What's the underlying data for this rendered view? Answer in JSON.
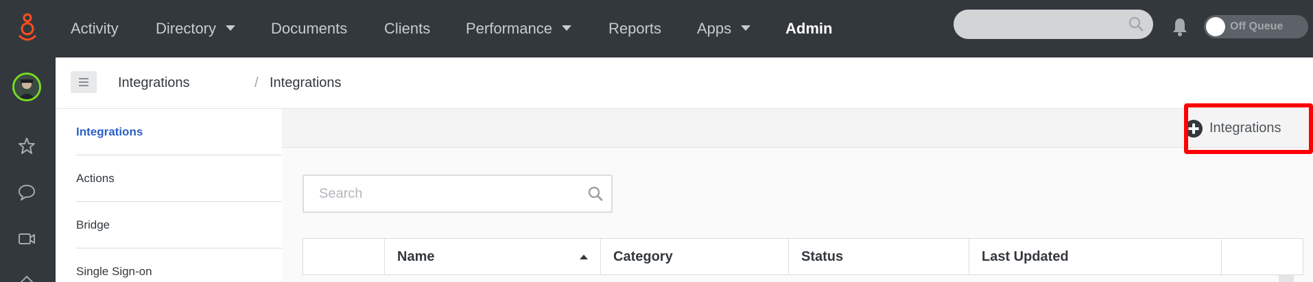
{
  "topnav": {
    "items": [
      {
        "label": "Activity"
      },
      {
        "label": "Directory"
      },
      {
        "label": "Documents"
      },
      {
        "label": "Clients"
      },
      {
        "label": "Performance"
      },
      {
        "label": "Reports"
      },
      {
        "label": "Apps"
      },
      {
        "label": "Admin"
      }
    ],
    "search_placeholder": "",
    "queue_label": "Off Queue",
    "accent_color": "#ff4f1f"
  },
  "rail": {
    "icons": [
      "star-icon",
      "chat-bubble-icon",
      "video-camera-icon"
    ]
  },
  "breadcrumb": {
    "items": [
      "Integrations",
      "Integrations"
    ],
    "separator": "/"
  },
  "subnav": {
    "items": [
      {
        "label": "Integrations"
      },
      {
        "label": "Actions"
      },
      {
        "label": "Bridge"
      },
      {
        "label": "Single Sign-on"
      }
    ],
    "active_color": "#2a60c8"
  },
  "main": {
    "add_button_label": "Integrations",
    "search_placeholder": "Search",
    "columns": [
      "Name",
      "Category",
      "Status",
      "Last Updated"
    ],
    "sorted_column": "Name",
    "sort_direction": "ascending"
  }
}
